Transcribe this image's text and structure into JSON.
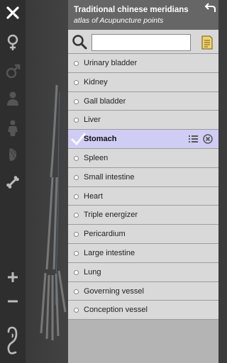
{
  "panel": {
    "title": "Traditional chinese meridians",
    "subtitle": "atlas of Acupuncture points"
  },
  "search": {
    "value": "",
    "placeholder": ""
  },
  "meridians": [
    {
      "label": "Urinary bladder",
      "selected": false
    },
    {
      "label": "Kidney",
      "selected": false
    },
    {
      "label": "Gall bladder",
      "selected": false
    },
    {
      "label": "Liver",
      "selected": false
    },
    {
      "label": "Stomach",
      "selected": true
    },
    {
      "label": "Spleen",
      "selected": false
    },
    {
      "label": "Small intestine",
      "selected": false
    },
    {
      "label": "Heart",
      "selected": false
    },
    {
      "label": "Triple energizer",
      "selected": false
    },
    {
      "label": "Pericardium",
      "selected": false
    },
    {
      "label": "Large intestine",
      "selected": false
    },
    {
      "label": "Lung",
      "selected": false
    },
    {
      "label": "Governing vessel",
      "selected": false
    },
    {
      "label": "Conception vessel",
      "selected": false
    }
  ],
  "toolbar": {
    "icons": [
      "close-icon",
      "female-icon",
      "male-icon",
      "person-skin-icon",
      "person-body-icon",
      "muscle-icon",
      "bone-icon",
      "zoom-in-icon",
      "zoom-out-icon",
      "ear-icon"
    ]
  },
  "colors": {
    "panel_header": "#666666",
    "list_item": "#d9d9d9",
    "selected_item": "#cfcdf3",
    "toolbar": "#2e2e2e"
  }
}
